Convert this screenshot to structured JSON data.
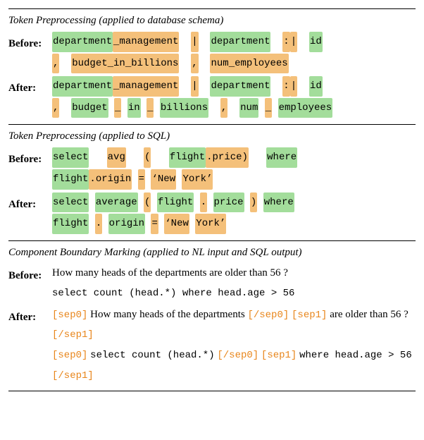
{
  "sections": [
    {
      "title": "Token Preprocessing (applied to database schema)",
      "rows": [
        {
          "label": "Before",
          "segments": [
            {
              "t": " ",
              "c": ""
            },
            {
              "t": "department",
              "c": "inv"
            },
            {
              "t": "_management",
              "c": "oov"
            },
            {
              "t": "  ",
              "c": ""
            },
            {
              "t": "|",
              "c": "oov"
            },
            {
              "t": "  ",
              "c": ""
            },
            {
              "t": "department",
              "c": "inv"
            },
            {
              "t": "  ",
              "c": ""
            },
            {
              "t": ":",
              "c": "oov"
            },
            {
              "t": "|",
              "c": "oov"
            },
            {
              "t": "  ",
              "c": ""
            },
            {
              "t": "id",
              "c": "inv"
            },
            {
              "t": "\n",
              "c": ""
            },
            {
              "t": ",",
              "c": "oov"
            },
            {
              "t": "  ",
              "c": ""
            },
            {
              "t": "budget_in_billions",
              "c": "oov"
            },
            {
              "t": "  ",
              "c": ""
            },
            {
              "t": ",",
              "c": "oov"
            },
            {
              "t": "  ",
              "c": ""
            },
            {
              "t": "num_employees",
              "c": "oov"
            }
          ]
        },
        {
          "label": "After",
          "segments": [
            {
              "t": " ",
              "c": ""
            },
            {
              "t": "department",
              "c": "inv"
            },
            {
              "t": "_management",
              "c": "oov"
            },
            {
              "t": "  ",
              "c": ""
            },
            {
              "t": "|",
              "c": "oov"
            },
            {
              "t": "  ",
              "c": ""
            },
            {
              "t": "department",
              "c": "inv"
            },
            {
              "t": "  ",
              "c": ""
            },
            {
              "t": ":",
              "c": "oov"
            },
            {
              "t": "|",
              "c": "oov"
            },
            {
              "t": "  ",
              "c": ""
            },
            {
              "t": "id",
              "c": "inv"
            },
            {
              "t": "\n",
              "c": ""
            },
            {
              "t": ",",
              "c": "oov"
            },
            {
              "t": "  ",
              "c": ""
            },
            {
              "t": "budget",
              "c": "inv"
            },
            {
              "t": " ",
              "c": ""
            },
            {
              "t": "_",
              "c": "oov"
            },
            {
              "t": " ",
              "c": ""
            },
            {
              "t": "in",
              "c": "inv"
            },
            {
              "t": " ",
              "c": ""
            },
            {
              "t": "_",
              "c": "oov"
            },
            {
              "t": " ",
              "c": ""
            },
            {
              "t": "billions",
              "c": "inv"
            },
            {
              "t": "  ",
              "c": ""
            },
            {
              "t": ",",
              "c": "oov"
            },
            {
              "t": "  ",
              "c": ""
            },
            {
              "t": "num",
              "c": "inv"
            },
            {
              "t": " ",
              "c": ""
            },
            {
              "t": "_",
              "c": "oov"
            },
            {
              "t": " ",
              "c": ""
            },
            {
              "t": "employees",
              "c": "inv"
            }
          ]
        }
      ]
    },
    {
      "title": "Token Preprocessing (applied to SQL)",
      "rows": [
        {
          "label": "Before",
          "segments": [
            {
              "t": " ",
              "c": ""
            },
            {
              "t": "select",
              "c": "inv"
            },
            {
              "t": "   ",
              "c": ""
            },
            {
              "t": "avg",
              "c": "oov"
            },
            {
              "t": "   ",
              "c": ""
            },
            {
              "t": "(",
              "c": "oov"
            },
            {
              "t": "   ",
              "c": ""
            },
            {
              "t": "flight",
              "c": "inv"
            },
            {
              "t": ".price)",
              "c": "oov"
            },
            {
              "t": "   ",
              "c": ""
            },
            {
              "t": "where",
              "c": "inv"
            },
            {
              "t": "\n",
              "c": ""
            },
            {
              "t": "flight",
              "c": "inv"
            },
            {
              "t": ".origin",
              "c": "oov"
            },
            {
              "t": " ",
              "c": ""
            },
            {
              "t": "=",
              "c": "oov"
            },
            {
              "t": " ",
              "c": ""
            },
            {
              "t": "‘New",
              "c": "oov"
            },
            {
              "t": " ",
              "c": ""
            },
            {
              "t": "York’",
              "c": "oov"
            }
          ]
        },
        {
          "label": "After",
          "segments": [
            {
              "t": " ",
              "c": ""
            },
            {
              "t": "select",
              "c": "inv"
            },
            {
              "t": " ",
              "c": ""
            },
            {
              "t": "average",
              "c": "inv"
            },
            {
              "t": " ",
              "c": ""
            },
            {
              "t": "(",
              "c": "oov"
            },
            {
              "t": " ",
              "c": ""
            },
            {
              "t": "flight",
              "c": "inv"
            },
            {
              "t": " ",
              "c": ""
            },
            {
              "t": ".",
              "c": "oov"
            },
            {
              "t": " ",
              "c": ""
            },
            {
              "t": "price",
              "c": "inv"
            },
            {
              "t": " ",
              "c": ""
            },
            {
              "t": ")",
              "c": "oov"
            },
            {
              "t": " ",
              "c": ""
            },
            {
              "t": "where",
              "c": "inv"
            },
            {
              "t": "\n",
              "c": ""
            },
            {
              "t": "flight",
              "c": "inv"
            },
            {
              "t": " ",
              "c": ""
            },
            {
              "t": ".",
              "c": "oov"
            },
            {
              "t": " ",
              "c": ""
            },
            {
              "t": "origin",
              "c": "inv"
            },
            {
              "t": " ",
              "c": ""
            },
            {
              "t": "=",
              "c": "oov"
            },
            {
              "t": " ",
              "c": ""
            },
            {
              "t": "‘New",
              "c": "oov"
            },
            {
              "t": " ",
              "c": ""
            },
            {
              "t": "York’",
              "c": "oov"
            }
          ]
        }
      ]
    },
    {
      "title": "Component Boundary Marking (applied to NL input and SQL output)",
      "rows": [
        {
          "label": "Before",
          "segments": [
            {
              "t": "How many heads of the departments are older than 56 ?",
              "c": "plain"
            },
            {
              "t": "\n",
              "c": ""
            },
            {
              "t": "select count (head.*) where head.age > 56",
              "c": "mono"
            }
          ]
        },
        {
          "label": "After",
          "segments": [
            {
              "t": "[sep0]",
              "c": "tag"
            },
            {
              "t": " How many heads of the departments ",
              "c": "plain"
            },
            {
              "t": "[/sep0]",
              "c": "tag"
            },
            {
              "t": " ",
              "c": ""
            },
            {
              "t": "[sep1]",
              "c": "tag"
            },
            {
              "t": " are older than 56 ? ",
              "c": "plain"
            },
            {
              "t": "[/sep1]",
              "c": "tag"
            },
            {
              "t": "\n",
              "c": ""
            },
            {
              "t": "[sep0]",
              "c": "tag"
            },
            {
              "t": " ",
              "c": ""
            },
            {
              "t": "select count (head.*)",
              "c": "mono"
            },
            {
              "t": " ",
              "c": ""
            },
            {
              "t": "[/sep0]",
              "c": "tag"
            },
            {
              "t": " ",
              "c": ""
            },
            {
              "t": "[sep1]",
              "c": "tag"
            },
            {
              "t": " ",
              "c": ""
            },
            {
              "t": "where head.age > 56",
              "c": "mono"
            },
            {
              "t": " ",
              "c": ""
            },
            {
              "t": "[/sep1]",
              "c": "tag"
            }
          ]
        }
      ]
    }
  ]
}
